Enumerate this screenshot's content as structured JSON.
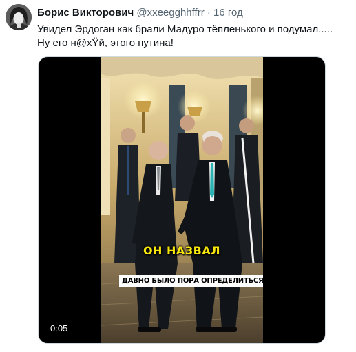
{
  "author": {
    "name": "Борис Викторович",
    "handle": "@xxeegghhffrr",
    "separator": "·",
    "time": "16 год"
  },
  "tweet": {
    "line1": "Увидел Эрдоган как брали Мадуро тёпленького и подумал.....",
    "line2": "Ну его н@хŸй, этого путина!"
  },
  "video": {
    "caption_primary": "ОН НАЗВАЛ",
    "caption_secondary": "ДАВНО БЫЛО ПОРА ОПРЕДЕЛИТЬСЯ",
    "elapsed": "0:05"
  }
}
